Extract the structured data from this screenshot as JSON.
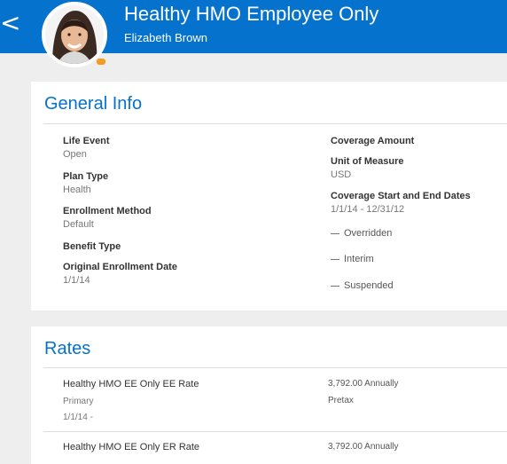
{
  "header": {
    "title": "Healthy HMO Employee Only",
    "subtitle": "Elizabeth Brown",
    "back_icon": "<"
  },
  "general": {
    "title": "General Info",
    "left_fields": [
      {
        "label": "Life Event",
        "value": "Open"
      },
      {
        "label": "Plan Type",
        "value": "Health"
      },
      {
        "label": "Enrollment Method",
        "value": "Default"
      },
      {
        "label": "Benefit Type",
        "value": ""
      },
      {
        "label": "Original Enrollment Date",
        "value": "1/1/14"
      }
    ],
    "right_fields": [
      {
        "label": "Coverage Amount",
        "value": ""
      },
      {
        "label": "Unit of Measure",
        "value": "USD"
      },
      {
        "label": "Coverage Start and End Dates",
        "value": "1/1/14 - 12/31/12"
      }
    ],
    "statuses": [
      "Overridden",
      "Interim",
      "Suspended"
    ]
  },
  "rates": {
    "title": "Rates",
    "items": [
      {
        "name": "Healthy HMO EE Only EE Rate",
        "line1": "Primary",
        "line2": "1/1/14 -",
        "amount": "3,792.00",
        "unit": "Annually",
        "tax": "Pretax"
      },
      {
        "name": "Healthy HMO EE Only ER Rate",
        "amount": "3,792.00",
        "unit": "Annually"
      }
    ]
  },
  "colors": {
    "accent": "#0572ce",
    "badge": "#f59a23"
  }
}
